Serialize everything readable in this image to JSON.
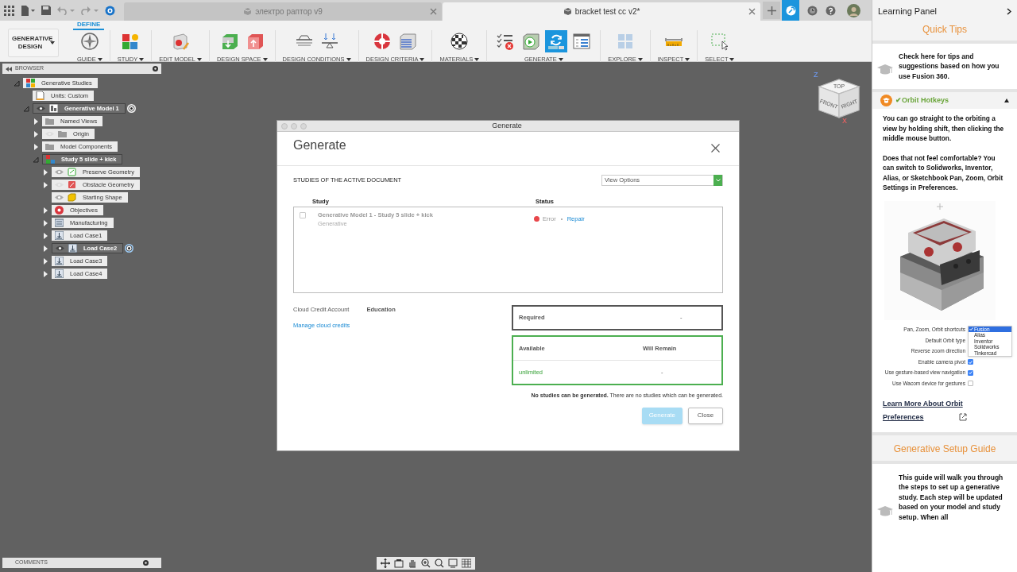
{
  "doc_tabs": [
    {
      "title": "электро раптор v9",
      "selected": false
    },
    {
      "title": "bracket test cc v2*",
      "selected": true
    }
  ],
  "ribbon": {
    "workspace": "GENERATIVE DESIGN",
    "tab": "DEFINE",
    "groups": [
      {
        "label": "GUIDE",
        "buttons": [
          {
            "selected": false
          }
        ]
      },
      {
        "label": "STUDY",
        "buttons": [
          {
            "selected": false
          }
        ]
      },
      {
        "label": "EDIT MODEL",
        "buttons": [
          {
            "selected": false
          }
        ]
      },
      {
        "label": "DESIGN SPACE",
        "buttons": [
          {
            "selected": false
          },
          {
            "selected": false
          }
        ]
      },
      {
        "label": "DESIGN CONDITIONS",
        "buttons": [
          {
            "selected": false
          },
          {
            "selected": false
          }
        ]
      },
      {
        "label": "DESIGN CRITERIA",
        "buttons": [
          {
            "selected": false
          },
          {
            "selected": false
          }
        ]
      },
      {
        "label": "MATERIALS",
        "buttons": [
          {
            "selected": false
          }
        ]
      },
      {
        "label": "GENERATE",
        "buttons": [
          {
            "selected": false
          },
          {
            "selected": false
          },
          {
            "selected": true
          },
          {
            "selected": false
          }
        ]
      },
      {
        "label": "EXPLORE",
        "buttons": [
          {
            "selected": false
          }
        ]
      },
      {
        "label": "INSPECT",
        "buttons": [
          {
            "selected": false
          }
        ]
      },
      {
        "label": "SELECT",
        "buttons": [
          {
            "selected": false
          }
        ]
      }
    ]
  },
  "browser": {
    "title": "BROWSER",
    "tree": [
      {
        "label": "Generative Studies",
        "kind": "studies",
        "expanded": true,
        "selected": false,
        "active": false,
        "children": [
          {
            "label": "Units: Custom",
            "kind": "units",
            "selected": false,
            "active": false
          },
          {
            "label": "Generative Model 1",
            "kind": "model",
            "expanded": true,
            "visible": true,
            "selected": true,
            "active": true,
            "children": [
              {
                "label": "Named Views",
                "kind": "folder",
                "expanded": false,
                "selected": false,
                "active": false
              },
              {
                "label": "Origin",
                "kind": "folder",
                "expanded": false,
                "visible": false,
                "selected": false,
                "active": false
              },
              {
                "label": "Model Components",
                "kind": "folder",
                "expanded": false,
                "selected": false,
                "active": false
              },
              {
                "label": "Study 5 slide + kick",
                "kind": "study",
                "expanded": true,
                "selected": true,
                "active": false,
                "children": [
                  {
                    "label": "Preserve Geometry",
                    "kind": "preserve",
                    "expanded": false,
                    "visible": true,
                    "selected": false,
                    "active": false
                  },
                  {
                    "label": "Obstacle Geometry",
                    "kind": "obstacle",
                    "expanded": false,
                    "visible": false,
                    "selected": false,
                    "active": false
                  },
                  {
                    "label": "Starting Shape",
                    "kind": "shape",
                    "visible": true,
                    "selected": false,
                    "active": false
                  },
                  {
                    "label": "Objectives",
                    "kind": "objectives",
                    "expanded": false,
                    "selected": false,
                    "active": false
                  },
                  {
                    "label": "Manufacturing",
                    "kind": "manufacturing",
                    "expanded": false,
                    "selected": false,
                    "active": false
                  },
                  {
                    "label": "Load Case1",
                    "kind": "loadcase",
                    "expanded": false,
                    "selected": false,
                    "active": false
                  },
                  {
                    "label": "Load Case2",
                    "kind": "loadcase",
                    "expanded": false,
                    "visible": true,
                    "selected": true,
                    "active": true
                  },
                  {
                    "label": "Load Case3",
                    "kind": "loadcase",
                    "expanded": false,
                    "selected": false,
                    "active": false
                  },
                  {
                    "label": "Load Case4",
                    "kind": "loadcase",
                    "expanded": false,
                    "selected": false,
                    "active": false
                  }
                ]
              }
            ]
          }
        ]
      }
    ]
  },
  "viewcube": {
    "faces": [
      "TOP",
      "FRONT",
      "RIGHT"
    ],
    "axes": [
      "Z",
      "X"
    ]
  },
  "dialog": {
    "window_title": "Generate",
    "heading": "Generate",
    "section": "STUDIES OF THE ACTIVE DOCUMENT",
    "view_options": "View Options",
    "columns": [
      "Study",
      "Status"
    ],
    "rows": [
      {
        "checked": false,
        "name": "Generative Model 1 - Study 5 slide + kick",
        "type": "Generative",
        "status": "Error",
        "color": "#e8474b",
        "action": "Repair"
      }
    ],
    "account_label": "Cloud Credit Account",
    "account_value": "Education",
    "manage_link": "Manage cloud credits",
    "required_label": "Required",
    "required_value": "-",
    "available_label": "Available",
    "remain_label": "Will Remain",
    "available_value": "unlimited",
    "remain_value": "-",
    "message": "**No studies can be generated.** There are no studies which can be generated.",
    "buttons": [
      {
        "label": "Generate",
        "disabled": true,
        "primary": true
      },
      {
        "label": "Close",
        "disabled": false,
        "primary": false
      }
    ]
  },
  "comments": {
    "title": "COMMENTS"
  },
  "learning_panel": {
    "title": "Learning Panel",
    "quick_tips": "Quick Tips",
    "tip": "Check here for tips and suggestions based on how you use Fusion 360.",
    "card": {
      "check": "✔",
      "title": "Orbit Hotkeys",
      "expanded": true,
      "paragraphs": [
        "You can go straight to the orbiting a view by holding shift, then clicking the middle mouse button.",
        "Does that not feel comfortable? You can switch to Solidworks, Inventor, Alias, or Sketchbook Pan, Zoom, Orbit Settings in Preferences."
      ],
      "settings": [
        {
          "label": "Pan, Zoom, Orbit shortcuts",
          "kind": "dropdown"
        },
        {
          "label": "Default Orbit type",
          "kind": "hidden"
        },
        {
          "label": "Reverse zoom direction",
          "kind": "hidden"
        },
        {
          "label": "Enable camera pivot",
          "kind": "checkbox",
          "checked": true
        },
        {
          "label": "Use gesture-based view navigation",
          "kind": "checkbox",
          "checked": true
        },
        {
          "label": "Use Wacom device for gestures",
          "kind": "checkbox",
          "checked": false
        }
      ],
      "menu": [
        {
          "label": "Fusion",
          "selected": true
        },
        {
          "label": "Alias",
          "selected": false
        },
        {
          "label": "Inventor",
          "selected": false
        },
        {
          "label": "Solidworks",
          "selected": false
        },
        {
          "label": "Tinkercad",
          "selected": false
        }
      ],
      "link": "Learn More About Orbit Preferences"
    },
    "guide_title": "Generative Setup Guide",
    "guide_text": "This guide will walk you through the steps to set up a generative study. Each step will be updated based on your model and study setup. When all"
  }
}
